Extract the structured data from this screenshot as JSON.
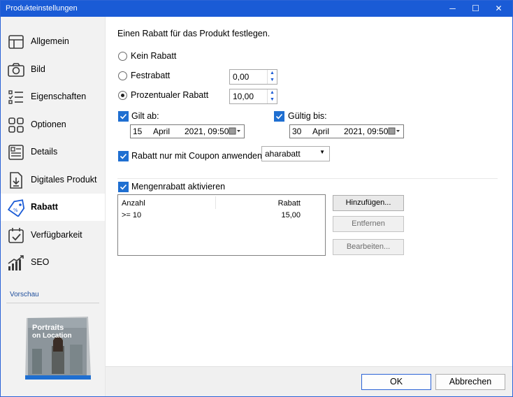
{
  "window": {
    "title": "Produkteinstellungen",
    "controls": {
      "minimize": "─",
      "maximize": "☐",
      "close": "✕"
    }
  },
  "sidebar": {
    "items": [
      {
        "label": "Allgemein",
        "icon": "layout-icon",
        "active": false
      },
      {
        "label": "Bild",
        "icon": "camera-icon",
        "active": false
      },
      {
        "label": "Eigenschaften",
        "icon": "list-icon",
        "active": false
      },
      {
        "label": "Optionen",
        "icon": "grid-icon",
        "active": false
      },
      {
        "label": "Details",
        "icon": "details-icon",
        "active": false
      },
      {
        "label": "Digitales Produkt",
        "icon": "download-file-icon",
        "active": false
      },
      {
        "label": "Rabatt",
        "icon": "tag-icon",
        "active": true
      },
      {
        "label": "Verfügbarkeit",
        "icon": "calendar-check-icon",
        "active": false
      },
      {
        "label": "SEO",
        "icon": "chart-icon",
        "active": false
      }
    ],
    "preview_label": "Vorschau",
    "preview_book": {
      "title_line1": "Portraits",
      "title_line2": "on Location"
    }
  },
  "main": {
    "heading": "Einen Rabatt für das Produkt festlegen.",
    "radios": {
      "kein": {
        "label": "Kein Rabatt",
        "selected": false
      },
      "fest": {
        "label": "Festrabatt",
        "selected": false,
        "value": "0,00"
      },
      "prozent": {
        "label": "Prozentualer Rabatt",
        "selected": true,
        "value": "10,00"
      }
    },
    "gilt_ab": {
      "label": "Gilt ab:",
      "checked": true,
      "day": "15",
      "month": "April",
      "year_time": "2021, 09:50"
    },
    "gueltig_bis": {
      "label": "Gültig bis:",
      "checked": true,
      "day": "30",
      "month": "April",
      "year_time": "2021, 09:50"
    },
    "coupon": {
      "label": "Rabatt nur mit Coupon anwenden:",
      "checked": true,
      "selected": "aharabatt"
    },
    "mengenrabatt": {
      "label": "Mengenrabatt aktivieren",
      "checked": true,
      "columns": [
        "Anzahl",
        "Rabatt"
      ],
      "rows": [
        {
          "anzahl": ">= 10",
          "rabatt": "15,00"
        }
      ]
    },
    "buttons": {
      "add": "Hinzufügen...",
      "remove": "Entfernen",
      "edit": "Bearbeiten..."
    }
  },
  "footer": {
    "ok": "OK",
    "cancel": "Abbrechen"
  },
  "colors": {
    "accent": "#1a5bd6",
    "checkbox": "#1f6fd1",
    "icon": "#3a3a3a"
  }
}
